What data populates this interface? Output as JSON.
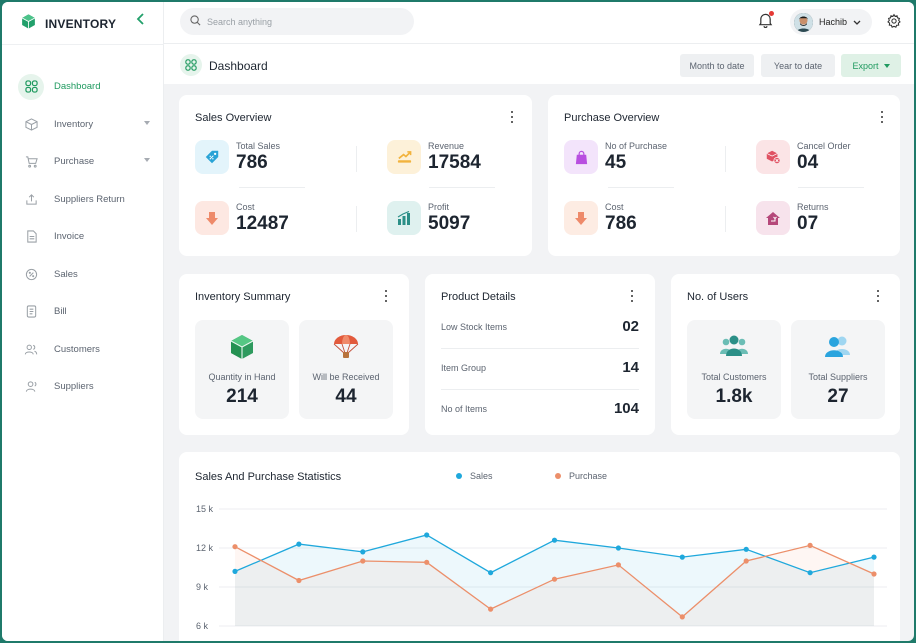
{
  "brand": {
    "name": "INVENTORY"
  },
  "sidebar": {
    "items": [
      {
        "label": "Dashboard",
        "icon": "dashboard-grid-icon",
        "active": true
      },
      {
        "label": "Inventory",
        "icon": "box-icon",
        "has_submenu": true
      },
      {
        "label": "Purchase",
        "icon": "cart-icon",
        "has_submenu": true
      },
      {
        "label": "Suppliers Return",
        "icon": "return-upload-icon"
      },
      {
        "label": "Invoice",
        "icon": "invoice-document-icon"
      },
      {
        "label": "Sales",
        "icon": "sales-percent-icon"
      },
      {
        "label": "Bill",
        "icon": "bill-icon"
      },
      {
        "label": "Customers",
        "icon": "users-icon"
      },
      {
        "label": "Suppliers",
        "icon": "user-icon"
      }
    ]
  },
  "topbar": {
    "search_placeholder": "Search anything",
    "user_name": "Hachib",
    "notification_dot": true
  },
  "header": {
    "title": "Dashboard",
    "btn_month": "Month to date",
    "btn_year": "Year to date",
    "btn_export": "Export"
  },
  "sales_overview": {
    "title": "Sales Overview",
    "total_sales": {
      "label": "Total Sales",
      "value": "786",
      "icon": "tag-percent-icon"
    },
    "revenue": {
      "label": "Revenue",
      "value": "17584",
      "icon": "revenue-chart-icon"
    },
    "cost": {
      "label": "Cost",
      "value": "12487",
      "icon": "cost-down-arrow-icon"
    },
    "profit": {
      "label": "Profit",
      "value": "5097",
      "icon": "profit-bar-chart-icon"
    }
  },
  "purchase_overview": {
    "title": "Purchase Overview",
    "no_of_purchase": {
      "label": "No of Purchase",
      "value": "45",
      "icon": "shopping-bag-icon"
    },
    "cancel_order": {
      "label": "Cancel Order",
      "value": "04",
      "icon": "cancel-box-icon"
    },
    "cost": {
      "label": "Cost",
      "value": "786",
      "icon": "cost-down-arrow-icon"
    },
    "returns": {
      "label": "Returns",
      "value": "07",
      "icon": "returns-house-icon"
    }
  },
  "inventory_summary": {
    "title": "Inventory Summary",
    "quantity": {
      "label": "Quantity in Hand",
      "value": "214",
      "icon": "cube-icon"
    },
    "received": {
      "label": "Will be Received",
      "value": "44",
      "icon": "parachute-icon"
    }
  },
  "product_details": {
    "title": "Product Details",
    "rows": [
      {
        "label": "Low Stock Items",
        "value": "02"
      },
      {
        "label": "Item Group",
        "value": "14"
      },
      {
        "label": "No of Items",
        "value": "104"
      }
    ]
  },
  "users": {
    "title": "No. of Users",
    "customers": {
      "label": "Total Customers",
      "value": "1.8k",
      "icon": "customers-group-icon"
    },
    "suppliers": {
      "label": "Total Suppliers",
      "value": "27",
      "icon": "suppliers-pair-icon"
    }
  },
  "colors": {
    "accent": "#1f9a5f",
    "sales": "#1fa8dc",
    "purchase": "#ec8f6a"
  },
  "chart_data": {
    "type": "line",
    "title": "Sales And Purchase Statistics",
    "xlabel": "",
    "ylabel": "",
    "yticks": [
      "15 k",
      "12 k",
      "9 k",
      "6 k"
    ],
    "ylim": [
      6000,
      15000
    ],
    "x": [
      1,
      2,
      3,
      4,
      5,
      6,
      7,
      8,
      9,
      10,
      11
    ],
    "series": [
      {
        "name": "Sales",
        "values": [
          10200,
          12300,
          11700,
          13000,
          10100,
          12600,
          12000,
          11300,
          11900,
          10100,
          11300
        ]
      },
      {
        "name": "Purchase",
        "values": [
          12100,
          9500,
          11000,
          10900,
          7300,
          9600,
          10700,
          6700,
          11000,
          12200,
          10000
        ]
      }
    ],
    "legend": "top",
    "grid": true
  }
}
